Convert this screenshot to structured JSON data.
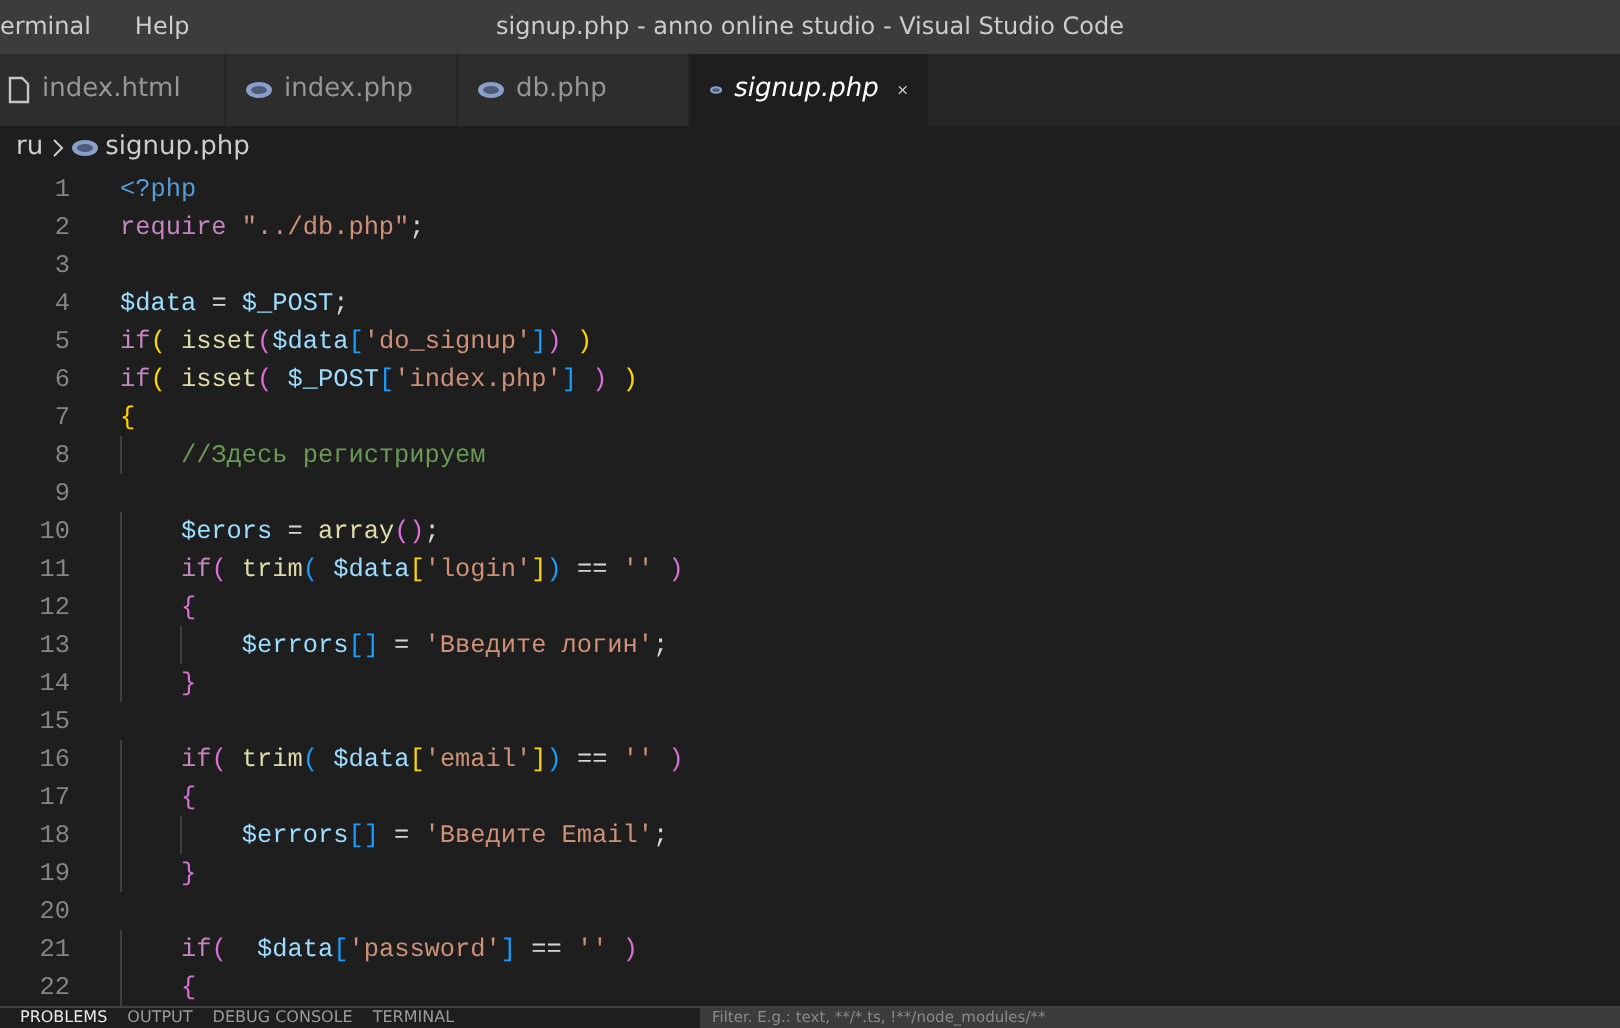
{
  "window": {
    "title": "signup.php - anno online studio - Visual Studio Code"
  },
  "menu": [
    "erminal",
    "Help"
  ],
  "tabs": [
    {
      "label": "index.html",
      "kind": "file",
      "selected": false
    },
    {
      "label": "index.php",
      "kind": "php",
      "selected": false
    },
    {
      "label": "db.php",
      "kind": "php",
      "selected": false
    },
    {
      "label": "signup.php",
      "kind": "php",
      "selected": true
    }
  ],
  "breadcrumb": [
    {
      "label": "ru",
      "kind": "folder"
    },
    {
      "label": "signup.php",
      "kind": "php"
    }
  ],
  "editor": {
    "lines": [
      {
        "number": "1",
        "tokens": [
          {
            "kind": "kw",
            "text": "<?php"
          }
        ]
      },
      {
        "number": "2",
        "tokens": [
          {
            "kind": "ctl",
            "text": "require"
          },
          {
            "kind": "str",
            "text": " \"../db.php\""
          },
          {
            "kind": "plain",
            "text": ";"
          }
        ]
      },
      {
        "number": "3"
      },
      {
        "number": "4",
        "tokens": [
          {
            "kind": "var",
            "text": "$data"
          },
          {
            "kind": "plain",
            "text": " = "
          },
          {
            "kind": "var",
            "text": "$_POST"
          },
          {
            "kind": "plain",
            "text": ";"
          }
        ]
      },
      {
        "number": "5",
        "tokens": [
          {
            "kind": "ctl",
            "text": "if"
          },
          {
            "kind": "b1",
            "text": "("
          },
          {
            "kind": "fn",
            "text": " isset"
          },
          {
            "kind": "b2",
            "text": "("
          },
          {
            "kind": "var",
            "text": "$data"
          },
          {
            "kind": "b3",
            "text": "["
          },
          {
            "kind": "str",
            "text": "'do_signup'"
          },
          {
            "kind": "b3",
            "text": "]"
          },
          {
            "kind": "b2",
            "text": ")"
          },
          {
            "kind": "b1",
            "text": " )"
          }
        ]
      },
      {
        "number": "6",
        "tokens": [
          {
            "kind": "ctl",
            "text": "if"
          },
          {
            "kind": "b1",
            "text": "("
          },
          {
            "kind": "fn",
            "text": " isset"
          },
          {
            "kind": "b2",
            "text": "("
          },
          {
            "kind": "var",
            "text": " $_POST"
          },
          {
            "kind": "b3",
            "text": "["
          },
          {
            "kind": "str",
            "text": "'index.php'"
          },
          {
            "kind": "b3",
            "text": "]"
          },
          {
            "kind": "b2",
            "text": " )"
          },
          {
            "kind": "b1",
            "text": " )"
          }
        ]
      },
      {
        "number": "7",
        "tokens": [
          {
            "kind": "b1",
            "text": "{"
          }
        ]
      },
      {
        "number": "8",
        "tokens": [
          {
            "kind": "cmt",
            "text": "    //Здесь регистрируем"
          }
        ]
      },
      {
        "number": "9"
      },
      {
        "number": "10",
        "tokens": [
          {
            "kind": "var",
            "text": "    $erors"
          },
          {
            "kind": "plain",
            "text": " = "
          },
          {
            "kind": "fn",
            "text": "array"
          },
          {
            "kind": "b2",
            "text": "()"
          },
          {
            "kind": "plain",
            "text": ";"
          }
        ]
      },
      {
        "number": "11",
        "tokens": [
          {
            "kind": "ctl",
            "text": "    if"
          },
          {
            "kind": "b2",
            "text": "("
          },
          {
            "kind": "fn",
            "text": " trim"
          },
          {
            "kind": "b3",
            "text": "("
          },
          {
            "kind": "var",
            "text": " $data"
          },
          {
            "kind": "b1",
            "text": "["
          },
          {
            "kind": "str",
            "text": "'login'"
          },
          {
            "kind": "b1",
            "text": "]"
          },
          {
            "kind": "b3",
            "text": ")"
          },
          {
            "kind": "plain",
            "text": " == "
          },
          {
            "kind": "str",
            "text": "''"
          },
          {
            "kind": "b2",
            "text": " )"
          }
        ]
      },
      {
        "number": "12",
        "tokens": [
          {
            "kind": "b2",
            "text": "    {"
          }
        ]
      },
      {
        "number": "13",
        "tokens": [
          {
            "kind": "var",
            "text": "        $errors"
          },
          {
            "kind": "b3",
            "text": "[]"
          },
          {
            "kind": "plain",
            "text": " = "
          },
          {
            "kind": "str",
            "text": "'Введите логин'"
          },
          {
            "kind": "plain",
            "text": ";"
          }
        ]
      },
      {
        "number": "14",
        "tokens": [
          {
            "kind": "b2",
            "text": "    }"
          }
        ]
      },
      {
        "number": "15"
      },
      {
        "number": "16",
        "tokens": [
          {
            "kind": "ctl",
            "text": "    if"
          },
          {
            "kind": "b2",
            "text": "("
          },
          {
            "kind": "fn",
            "text": " trim"
          },
          {
            "kind": "b3",
            "text": "("
          },
          {
            "kind": "var",
            "text": " $data"
          },
          {
            "kind": "b1",
            "text": "["
          },
          {
            "kind": "str",
            "text": "'email'"
          },
          {
            "kind": "b1",
            "text": "]"
          },
          {
            "kind": "b3",
            "text": ")"
          },
          {
            "kind": "plain",
            "text": " == "
          },
          {
            "kind": "str",
            "text": "''"
          },
          {
            "kind": "b2",
            "text": " )"
          }
        ]
      },
      {
        "number": "17",
        "tokens": [
          {
            "kind": "b2",
            "text": "    {"
          }
        ]
      },
      {
        "number": "18",
        "tokens": [
          {
            "kind": "var",
            "text": "        $errors"
          },
          {
            "kind": "b3",
            "text": "[]"
          },
          {
            "kind": "plain",
            "text": " = "
          },
          {
            "kind": "str",
            "text": "'Введите Email'"
          },
          {
            "kind": "plain",
            "text": ";"
          }
        ]
      },
      {
        "number": "19",
        "tokens": [
          {
            "kind": "b2",
            "text": "    }"
          }
        ]
      },
      {
        "number": "20"
      },
      {
        "number": "21",
        "tokens": [
          {
            "kind": "ctl",
            "text": "    if"
          },
          {
            "kind": "b2",
            "text": "("
          },
          {
            "kind": "var",
            "text": "  $data"
          },
          {
            "kind": "b3",
            "text": "["
          },
          {
            "kind": "str",
            "text": "'password'"
          },
          {
            "kind": "b3",
            "text": "]"
          },
          {
            "kind": "plain",
            "text": " == "
          },
          {
            "kind": "str",
            "text": "''"
          },
          {
            "kind": "b2",
            "text": " )"
          }
        ]
      },
      {
        "number": "22",
        "tokens": [
          {
            "kind": "b2",
            "text": "    {"
          }
        ]
      }
    ]
  },
  "panel": {
    "tabs": [
      {
        "label": "PROBLEMS",
        "selected": true
      },
      {
        "label": "OUTPUT",
        "selected": false
      },
      {
        "label": "DEBUG CONSOLE",
        "selected": false
      },
      {
        "label": "TERMINAL",
        "selected": false
      }
    ],
    "filter": {
      "placeholder": "Filter. E.g.: text, **/*.ts, !**/node_modules/**"
    }
  }
}
